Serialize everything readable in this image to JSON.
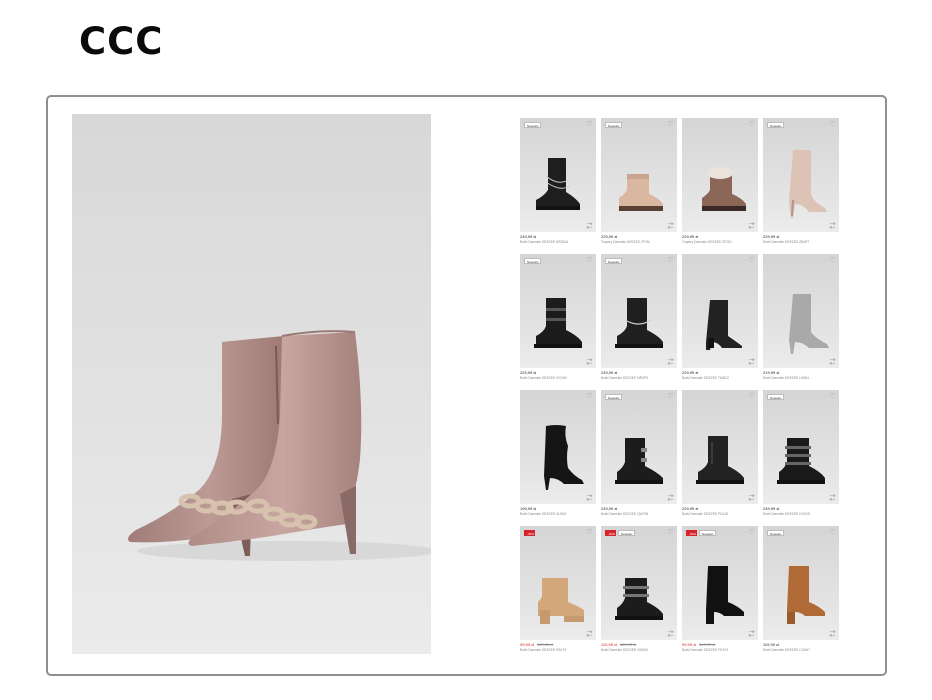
{
  "brand": {
    "logo_text": "CCC"
  },
  "hero": {
    "image": "pink-chain-stiletto-ankle-boots",
    "colors": {
      "boot": "#b38f8a",
      "chain": "#cdb9a4"
    }
  },
  "grid": {
    "colors": {
      "sale_badge": "#d6232a",
      "promo_price": "#d6232a"
    },
    "products": [
      {
        "badges": [
          "Nowości"
        ],
        "price": "249,99 zł",
        "old_price": "",
        "promo": false,
        "desc": "Botki Damskie DEEZEE AR283A",
        "shoe": "chain-combat-boot"
      },
      {
        "badges": [
          "Nowości"
        ],
        "price": "229,99 zł",
        "old_price": "",
        "promo": false,
        "desc": "Trapery Damskie DEEZEE ZP1M",
        "shoe": "beige-hiker"
      },
      {
        "badges": [],
        "price": "229,99 zł",
        "old_price": "",
        "promo": false,
        "desc": "Trapery Damskie DEEZEE ZF2K1",
        "shoe": "fur-hiker"
      },
      {
        "badges": [
          "Nowości"
        ],
        "price": "229,99 zł",
        "old_price": "",
        "promo": false,
        "desc": "Botki Damskie DEEZEE ZB4R7",
        "shoe": "beige-sock-stiletto"
      },
      {
        "badges": [
          "Nowości"
        ],
        "price": "229,99 zł",
        "old_price": "",
        "promo": false,
        "desc": "Botki Damskie DEEZEE XG3H0",
        "shoe": "buckle-biker"
      },
      {
        "badges": [
          "Nowości"
        ],
        "price": "249,99 zł",
        "old_price": "",
        "promo": false,
        "desc": "Botki Damskie DEEZEE MR2P9",
        "shoe": "chain-biker"
      },
      {
        "badges": [],
        "price": "229,99 zł",
        "old_price": "",
        "promo": false,
        "desc": "Botki Damskie DEEZEE TM5C2",
        "shoe": "block-heel-boot"
      },
      {
        "badges": [],
        "price": "219,99 zł",
        "old_price": "",
        "promo": false,
        "desc": "Botki Damskie DEEZEE LK8E4",
        "shoe": "grey-sock-stiletto"
      },
      {
        "badges": [],
        "price": "199,99 zł",
        "old_price": "",
        "promo": false,
        "desc": "Botki Damskie DEEZEE SL6N3",
        "shoe": "slouch-stiletto"
      },
      {
        "badges": [
          "Nowości"
        ],
        "price": "249,99 zł",
        "old_price": "",
        "promo": false,
        "desc": "Botki Damskie DEEZEE QW7B1",
        "shoe": "buckle-ankle-boot"
      },
      {
        "badges": [],
        "price": "229,99 zł",
        "old_price": "",
        "promo": false,
        "desc": "Botki Damskie DEEZEE PD4J8",
        "shoe": "combat-boot"
      },
      {
        "badges": [
          "Nowości"
        ],
        "price": "249,99 zł",
        "old_price": "",
        "promo": false,
        "desc": "Botki Damskie DEEZEE HV2S5",
        "shoe": "triple-buckle-boot"
      },
      {
        "badges": [
          "-30%"
        ],
        "price": "99,99 zł",
        "old_price": "149,99 zł",
        "promo": true,
        "desc": "Botki Damskie DEEZEE RB1T6",
        "shoe": "tan-block-boot"
      },
      {
        "badges": [
          "-30%",
          "Nowości"
        ],
        "price": "119,99 zł",
        "old_price": "169,99 zł",
        "promo": true,
        "desc": "Botki Damskie DEEZEE GN9U3",
        "shoe": "double-buckle-boot"
      },
      {
        "badges": [
          "-30%",
          "Nowości"
        ],
        "price": "99,99 zł",
        "old_price": "149,99 zł",
        "promo": true,
        "desc": "Botki Damskie DEEZEE FK3Y2",
        "shoe": "sock-block-boot"
      },
      {
        "badges": [
          "Nowości"
        ],
        "price": "119,99 zł",
        "old_price": "",
        "promo": false,
        "desc": "Botki Damskie DEEZEE CJ6W7",
        "shoe": "cognac-block-boot"
      }
    ]
  }
}
